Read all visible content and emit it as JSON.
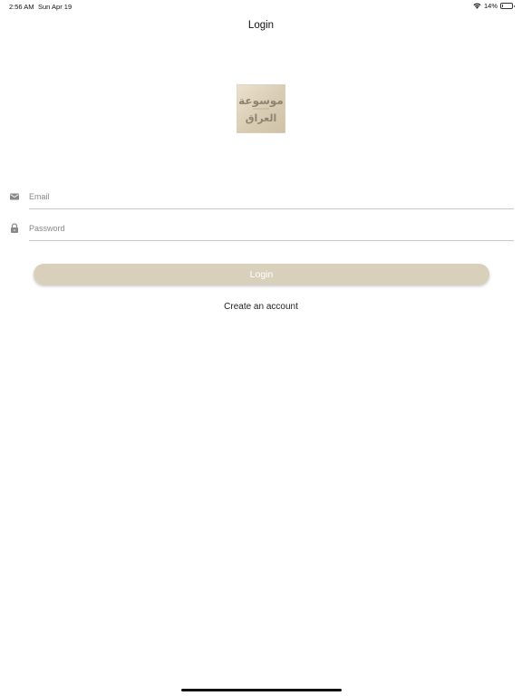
{
  "status_bar": {
    "time": "2:56 AM",
    "date": "Sun Apr 19",
    "battery_percent": "14%",
    "battery_level": 0.14,
    "wifi_icon": "wifi-icon",
    "battery_icon": "battery-icon"
  },
  "nav": {
    "title": "Login"
  },
  "logo": {
    "icon": "app-logo-icon",
    "text_line1": "موسوعة",
    "text_line2": "العراق",
    "background": "#d9ceb6"
  },
  "form": {
    "email": {
      "icon": "envelope-icon",
      "placeholder": "Email",
      "value": ""
    },
    "password": {
      "icon": "lock-icon",
      "placeholder": "Password",
      "value": ""
    },
    "login_label": "Login",
    "login_color": "#d9d0bc",
    "create_account_label": "Create an account"
  }
}
